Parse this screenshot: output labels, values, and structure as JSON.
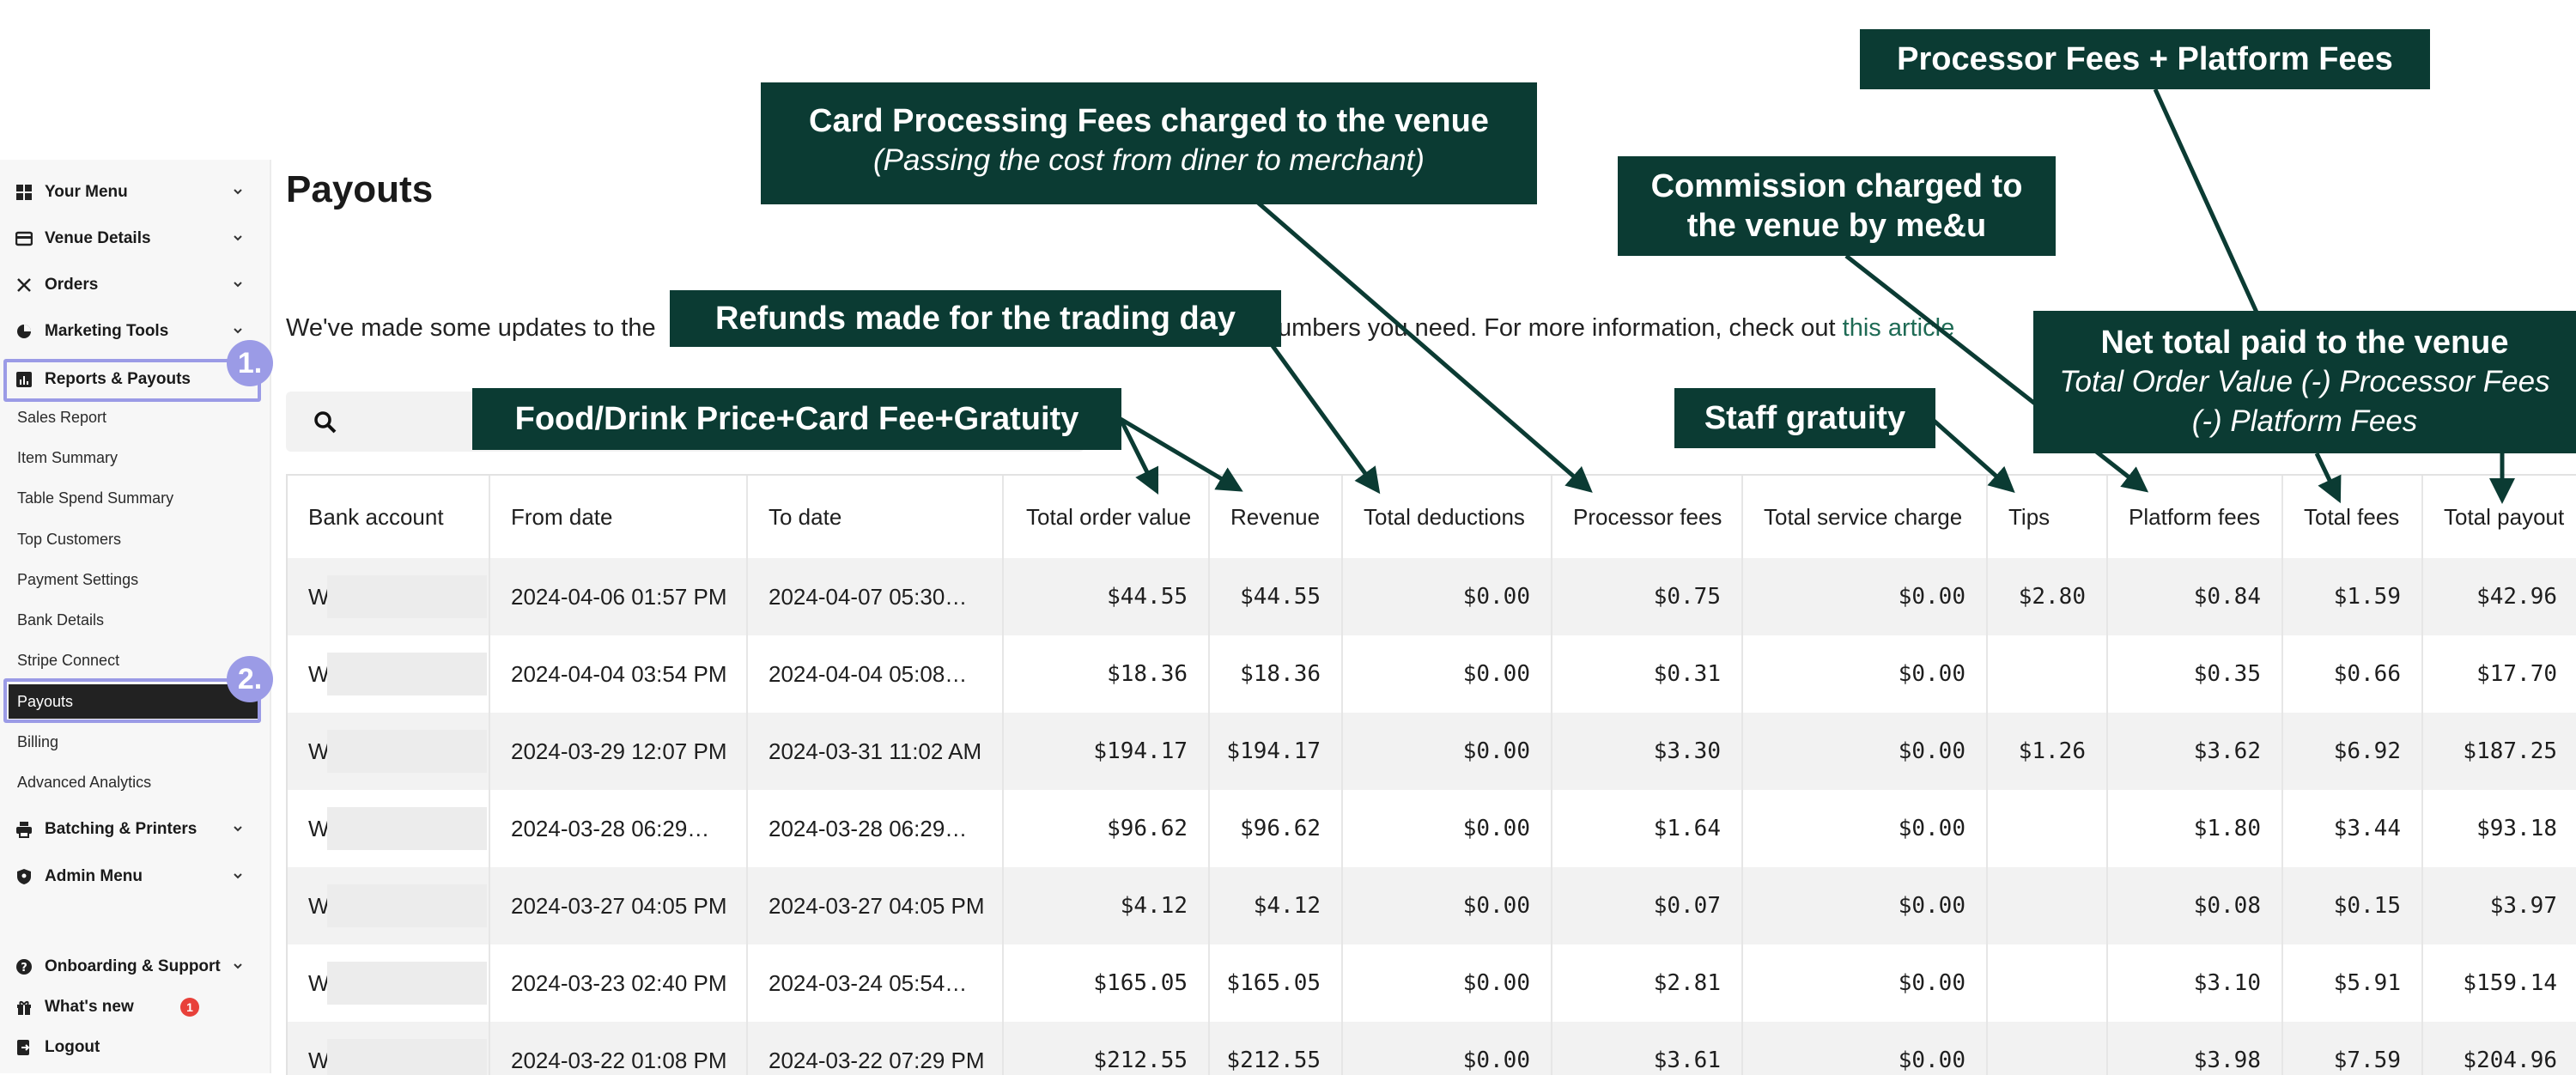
{
  "sidebar": {
    "groups": [
      {
        "label": "Your Menu",
        "icon": "grid-icon"
      },
      {
        "label": "Venue Details",
        "icon": "card-icon"
      },
      {
        "label": "Orders",
        "icon": "cutlery-icon"
      },
      {
        "label": "Marketing Tools",
        "icon": "pie-chart-icon"
      },
      {
        "label": "Reports & Payouts",
        "icon": "bar-chart-icon"
      }
    ],
    "sub_items": [
      "Sales Report",
      "Item Summary",
      "Table Spend Summary",
      "Top Customers",
      "Payment Settings",
      "Bank Details",
      "Stripe Connect",
      "Payouts",
      "Billing",
      "Advanced Analytics"
    ],
    "lower_groups": [
      {
        "label": "Batching & Printers",
        "icon": "printer-icon"
      },
      {
        "label": "Admin Menu",
        "icon": "shield-icon"
      }
    ],
    "footer": [
      {
        "label": "Onboarding & Support",
        "icon": "help-icon"
      },
      {
        "label": "What's new",
        "icon": "gift-icon",
        "badge": "1"
      },
      {
        "label": "Logout",
        "icon": "logout-icon"
      }
    ],
    "step_badges": [
      "1.",
      "2."
    ]
  },
  "main": {
    "title": "Payouts",
    "info_prefix": "We've made some updates to the",
    "info_suffix": "umbers you need. For more information, check out",
    "info_link": "this article"
  },
  "table": {
    "columns": [
      "Bank account",
      "From date",
      "To date",
      "Total order value",
      "Revenue",
      "Total deductions",
      "Processor fees",
      "Total service charge",
      "Tips",
      "Platform fees",
      "Total fees",
      "Total payout"
    ],
    "rows": [
      [
        "W",
        "2024-04-06 01:57 PM",
        "2024-04-07 05:30…",
        "$44.55",
        "$44.55",
        "$0.00",
        "$0.75",
        "$0.00",
        "$2.80",
        "$0.84",
        "$1.59",
        "$42.96"
      ],
      [
        "W",
        "2024-04-04 03:54 PM",
        "2024-04-04 05:08…",
        "$18.36",
        "$18.36",
        "$0.00",
        "$0.31",
        "$0.00",
        "",
        "$0.35",
        "$0.66",
        "$17.70"
      ],
      [
        "W",
        "2024-03-29 12:07 PM",
        "2024-03-31 11:02 AM",
        "$194.17",
        "$194.17",
        "$0.00",
        "$3.30",
        "$0.00",
        "$1.26",
        "$3.62",
        "$6.92",
        "$187.25"
      ],
      [
        "W",
        "2024-03-28 06:29…",
        "2024-03-28 06:29…",
        "$96.62",
        "$96.62",
        "$0.00",
        "$1.64",
        "$0.00",
        "",
        "$1.80",
        "$3.44",
        "$93.18"
      ],
      [
        "W",
        "2024-03-27 04:05 PM",
        "2024-03-27 04:05 PM",
        "$4.12",
        "$4.12",
        "$0.00",
        "$0.07",
        "$0.00",
        "",
        "$0.08",
        "$0.15",
        "$3.97"
      ],
      [
        "W",
        "2024-03-23 02:40 PM",
        "2024-03-24 05:54…",
        "$165.05",
        "$165.05",
        "$0.00",
        "$2.81",
        "$0.00",
        "",
        "$3.10",
        "$5.91",
        "$159.14"
      ],
      [
        "W",
        "2024-03-22 01:08 PM",
        "2024-03-22 07:29 PM",
        "$212.55",
        "$212.55",
        "$0.00",
        "$3.61",
        "$0.00",
        "",
        "$3.98",
        "$7.59",
        "$204.96"
      ]
    ]
  },
  "callouts": {
    "processor_platform": "Processor Fees + Platform Fees",
    "card_processing_title": "Card Processing Fees charged to the venue",
    "card_processing_sub": "(Passing the cost from diner to merchant)",
    "commission_line1": "Commission charged to",
    "commission_line2": "the venue by me&u",
    "refunds": "Refunds made for the trading day",
    "net_total_title": "Net total paid to the venue",
    "net_total_sub1": "Total Order Value (-) Processor Fees",
    "net_total_sub2": "(-) Platform Fees",
    "food_drink": "Food/Drink Price+Card Fee+Gratuity",
    "staff_gratuity": "Staff gratuity"
  },
  "colors": {
    "callout_bg": "#0b3b33",
    "highlight": "#9b9be6",
    "active_nav": "#222222",
    "link": "#1f6b55",
    "badge": "#e8413a"
  }
}
